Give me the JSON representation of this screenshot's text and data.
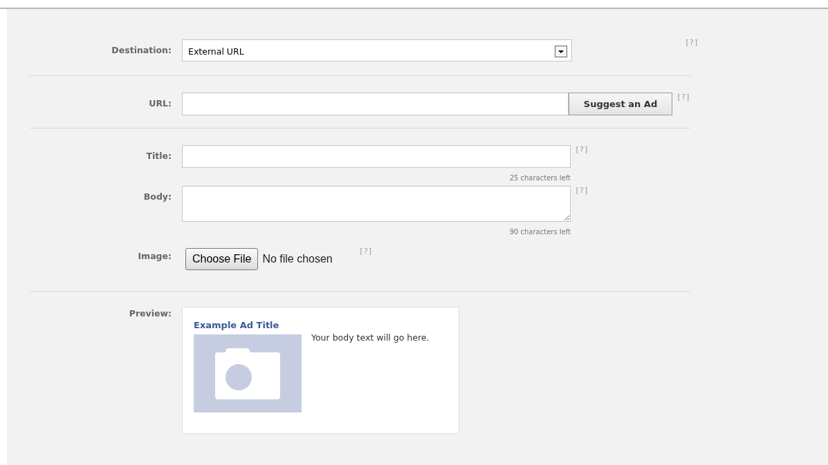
{
  "sections": [
    {
      "fields": [
        {
          "kind": "select",
          "label": "Destination:",
          "value": "External URL",
          "help": "[?]"
        }
      ]
    },
    {
      "fields": [
        {
          "kind": "url",
          "label": "URL:",
          "button": "Suggest an Ad",
          "help": "[?]"
        }
      ]
    },
    {
      "fields": [
        {
          "kind": "text",
          "label": "Title:",
          "counter": "25 characters left",
          "help": "[?]"
        },
        {
          "kind": "textarea",
          "label": "Body:",
          "counter": "90 characters left",
          "help": "[?]"
        },
        {
          "kind": "file",
          "label": "Image:",
          "button": "Choose File",
          "status": "No file chosen",
          "help": "[?]"
        }
      ]
    },
    {
      "fields": [
        {
          "kind": "preview",
          "label": "Preview:",
          "title": "Example Ad Title",
          "body": "Your body text will go here."
        }
      ]
    }
  ]
}
